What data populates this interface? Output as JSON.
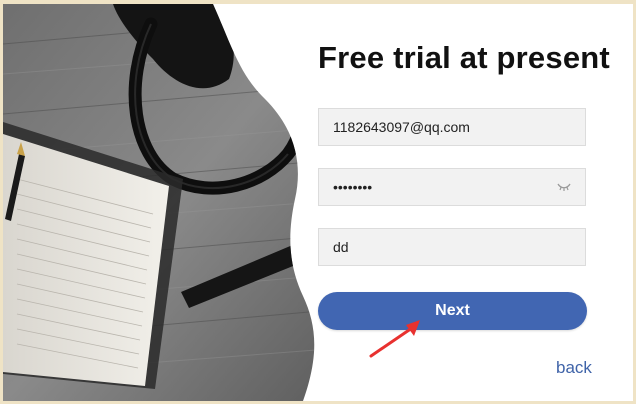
{
  "form": {
    "title": "Free trial at present",
    "email_value": "1182643097@qq.com",
    "password_value": "••••••••",
    "code_value": "dd",
    "next_label": "Next",
    "back_label": "back"
  },
  "icons": {
    "password_toggle": "eye-closed-icon",
    "pointer": "red-arrow-icon"
  },
  "colors": {
    "accent": "#4166b2",
    "link": "#3f63a8",
    "frame": "#efe3c5",
    "arrow": "#e8312f"
  }
}
